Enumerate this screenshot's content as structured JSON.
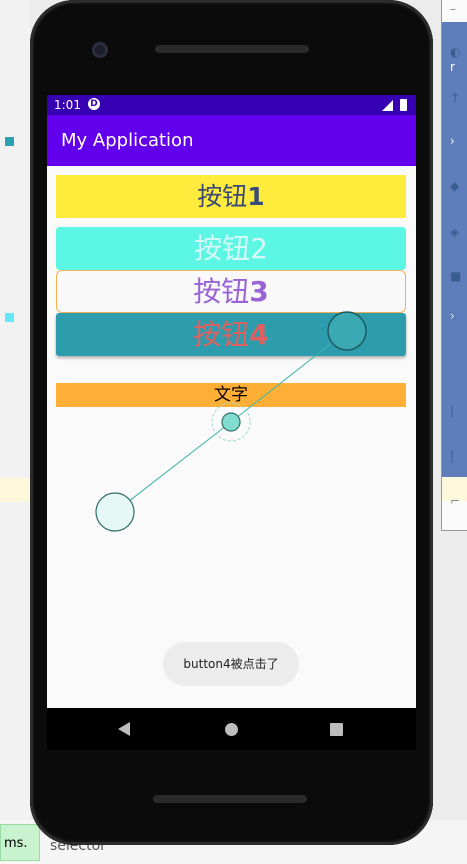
{
  "device": {
    "status_time": "1:01",
    "app_title": "My Application"
  },
  "buttons": [
    {
      "label_text": "按钮",
      "label_num": "1"
    },
    {
      "label_text": "按钮",
      "label_num": "2"
    },
    {
      "label_text": "按钮",
      "label_num": "3"
    },
    {
      "label_text": "按钮",
      "label_num": "4"
    }
  ],
  "text_view": "文字",
  "toast": "button4被点击了",
  "ide": {
    "left_panel_label": "ms.",
    "bottom_label": "selector"
  },
  "colors": {
    "status_bar": "#3700b3",
    "app_bar": "#6200ee",
    "button1_bg": "#ffeb3b",
    "button2_bg": "#5cf6e4",
    "button3_border": "#f5b050",
    "button4_bg": "#2d9dad",
    "text_bg": "#ffae36"
  },
  "icons": {
    "status_notification": "d-icon",
    "signal": "signal-icon",
    "battery": "battery-icon",
    "nav_back": "back-triangle-icon",
    "nav_home": "home-circle-icon",
    "nav_recent": "recent-square-icon"
  }
}
